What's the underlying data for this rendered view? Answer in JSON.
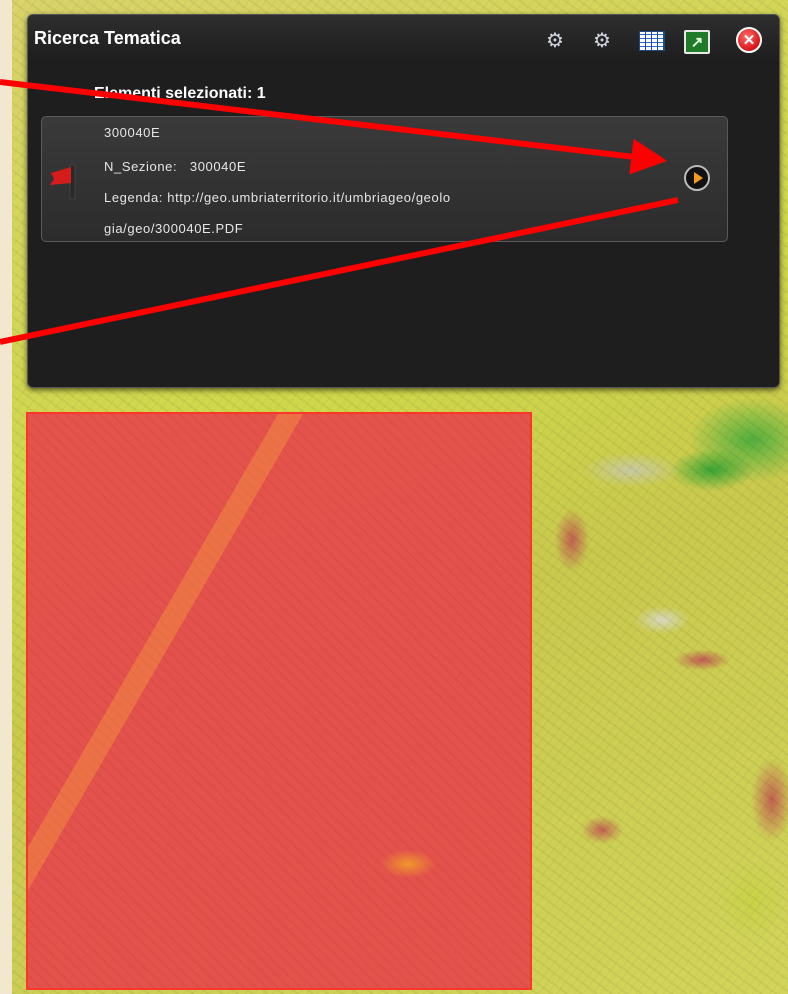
{
  "panel": {
    "title": "Ricerca Tematica",
    "icons": [
      "query-icon",
      "query-area-icon",
      "table-icon",
      "export-icon",
      "close-icon"
    ],
    "selected_count_label": "Elementi selezionati: 1"
  },
  "result": {
    "id": "300040E",
    "sezione_label": "N_Sezione:",
    "sezione_value": "300040E",
    "legenda_label": "Legenda:",
    "legenda_line1": "http://geo.umbriaterritorio.it/umbriageo/geolo",
    "legenda_line2": "gia/geo/300040E.PDF"
  },
  "colors": {
    "panel_bg": "#1e1e1e",
    "selection_fill": "#e6484c",
    "annotation_arrow": "#ff0000",
    "action_arrow": "#f29a1a"
  }
}
